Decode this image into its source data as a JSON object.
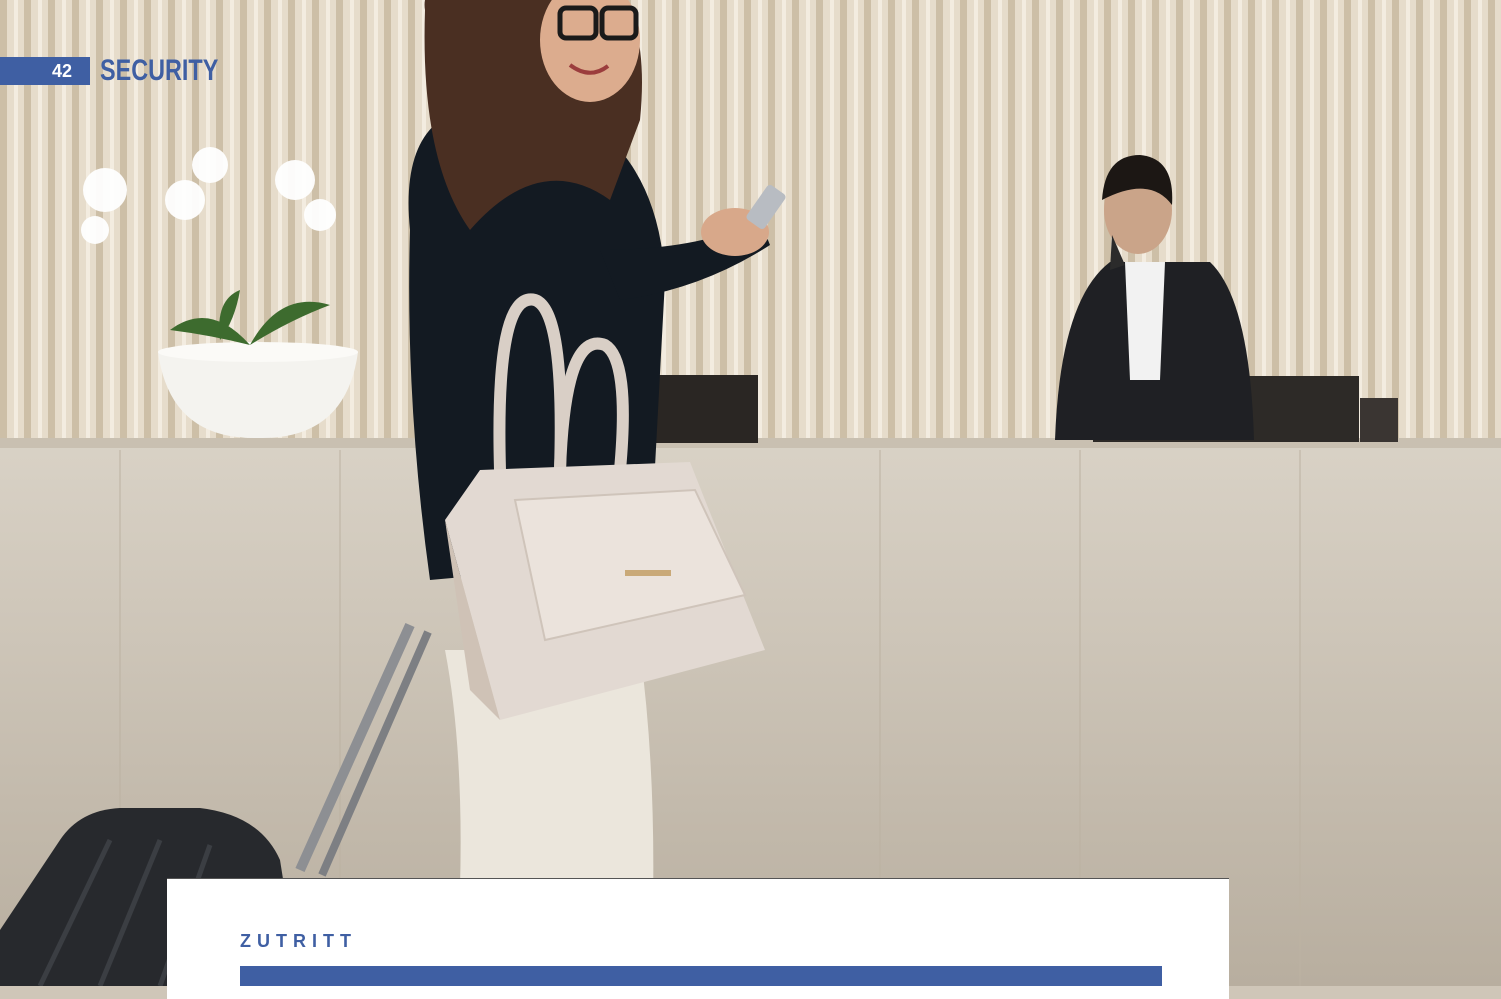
{
  "page": {
    "number": "42",
    "section": "SECURITY"
  },
  "card": {
    "kicker": "ZUTRITT"
  },
  "colors": {
    "accent": "#3f5fa3",
    "card_bg": "#ffffff"
  },
  "photo": {
    "subject": "hotel-lobby-guest-with-phone-and-luggage"
  }
}
